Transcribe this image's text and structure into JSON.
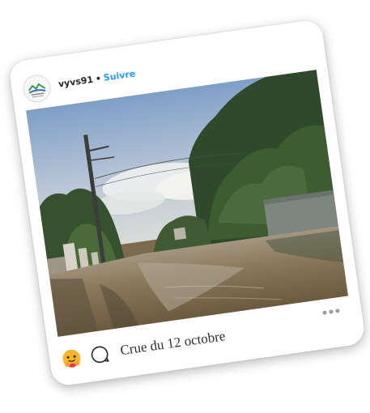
{
  "post": {
    "username": "vyvs91",
    "separator": "•",
    "follow_label": "Suivre",
    "caption": "Crue du 12 octobre",
    "photo_subject": "flooded residential street"
  },
  "icons": {
    "avatar": "profile-logo",
    "reaction": "hugging-face-emoji",
    "comment": "comment-bubble-icon",
    "more": "more-options-icon"
  },
  "colors": {
    "follow": "#2f9bf0",
    "text": "#262626",
    "caption": "#303030",
    "more_dots": "#9a9a9a",
    "water": "#7b6a4e"
  }
}
